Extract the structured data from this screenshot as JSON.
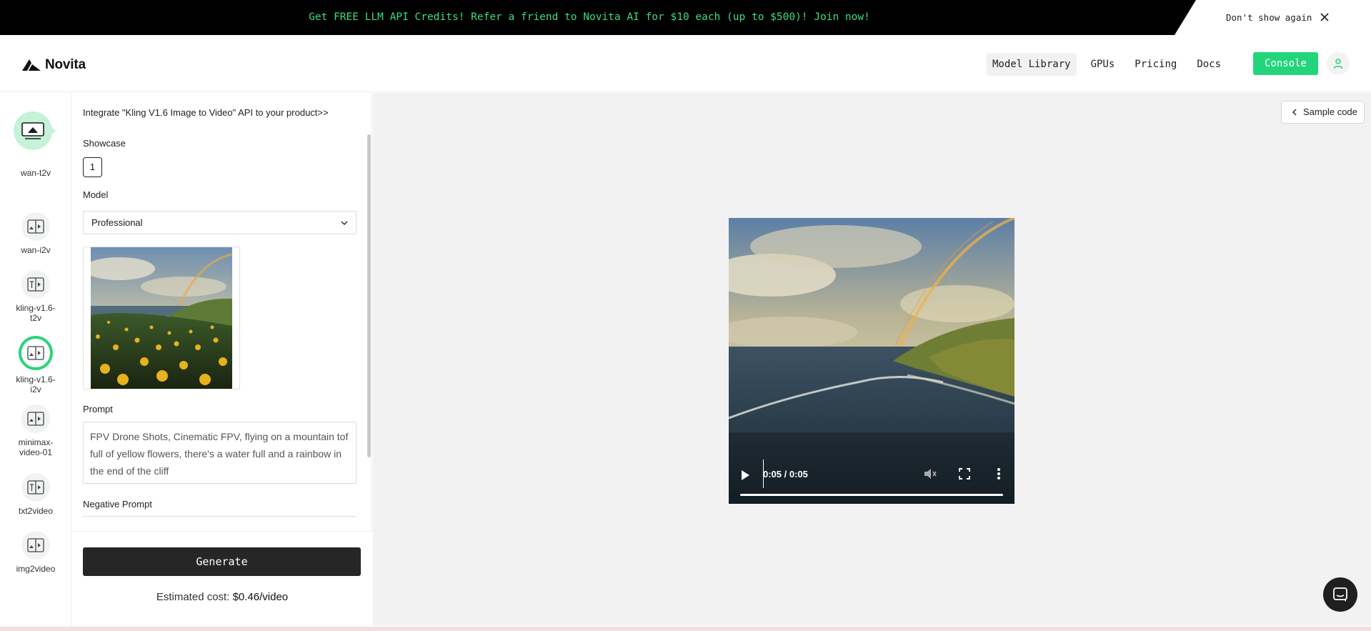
{
  "banner": {
    "text": "Get FREE LLM API Credits! Refer a friend to Novita AI for $10 each (up to $500)! Join now!",
    "dont_show": "Don't show again",
    "close_icon": "close-icon"
  },
  "header": {
    "logo_text": "Novita",
    "nav": [
      "Model Library",
      "GPUs",
      "Pricing",
      "Docs"
    ],
    "active_nav": "Model Library",
    "console_label": "Console",
    "user_icon": "user-icon"
  },
  "rail": {
    "items": [
      {
        "label": "wan-t2v",
        "icon": "text-to-video-icon"
      },
      {
        "label": "wan-i2v",
        "icon": "image-to-video-icon"
      },
      {
        "label": "kling-v1.6-t2v",
        "icon": "text-to-video-icon"
      },
      {
        "label": "kling-v1.6-i2v",
        "icon": "image-to-video-icon",
        "selected": true
      },
      {
        "label": "minimax-video-01",
        "icon": "image-to-video-icon"
      },
      {
        "label": "txt2video",
        "icon": "text-to-video-icon"
      },
      {
        "label": "img2video",
        "icon": "image-to-video-icon"
      }
    ]
  },
  "panel": {
    "integrate_link": "Integrate \"Kling V1.6 Image to Video\" API to your product>>",
    "showcase_label": "Showcase",
    "showcase_index": "1",
    "model_label": "Model",
    "model_value": "Professional",
    "prompt_label": "Prompt",
    "prompt_value": "FPV Drone Shots, Cinematic FPV, flying on a mountain tof full of yellow flowers, there's a water full and a rainbow in the end of the cliff",
    "negative_prompt_label": "Negative Prompt",
    "generate_label": "Generate",
    "cost_label": "Estimated cost:",
    "cost_value": "$0.46/video"
  },
  "main": {
    "sample_code_label": "Sample code",
    "video": {
      "time": "0:05 / 0:05",
      "progress": 1.0
    }
  },
  "colors": {
    "accent": "#23d57a",
    "banner_text": "#3ddc84",
    "selected_ring": "#2ed27b"
  }
}
